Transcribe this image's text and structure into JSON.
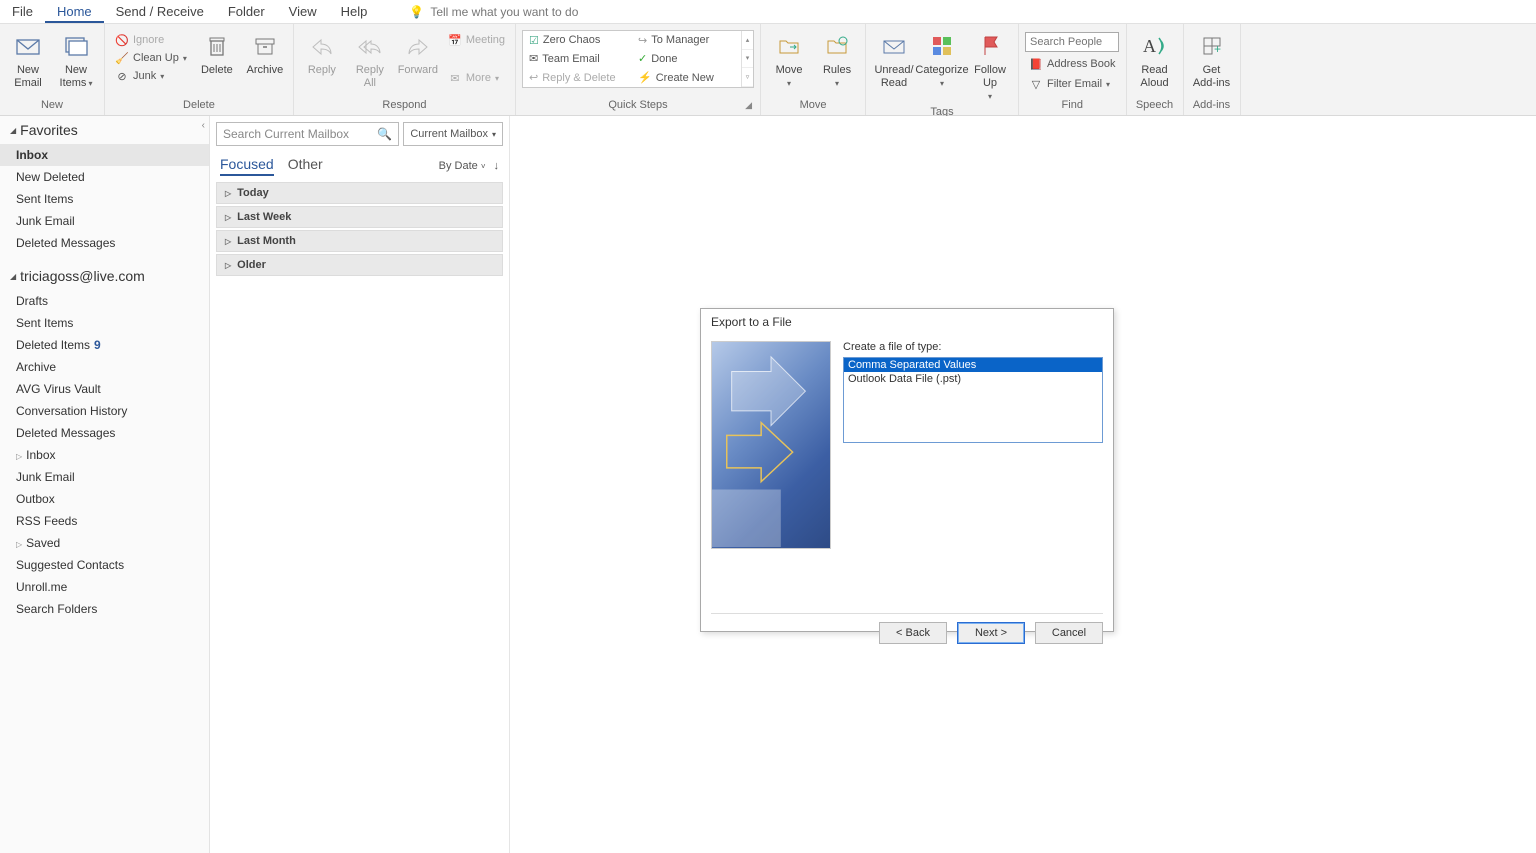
{
  "tabs": {
    "file": "File",
    "home": "Home",
    "send": "Send / Receive",
    "folder": "Folder",
    "view": "View",
    "help": "Help",
    "tellme": "Tell me what you want to do"
  },
  "ribbon": {
    "new": {
      "email": "New Email",
      "items": "New Items",
      "group": "New"
    },
    "delete": {
      "ignore": "Ignore",
      "cleanup": "Clean Up",
      "junk": "Junk",
      "delete": "Delete",
      "archive": "Archive",
      "group": "Delete"
    },
    "respond": {
      "reply": "Reply",
      "replyall": "Reply All",
      "forward": "Forward",
      "meeting": "Meeting",
      "more": "More",
      "group": "Respond"
    },
    "qs": {
      "zero": "Zero Chaos",
      "team": "Team Email",
      "replydel": "Reply & Delete",
      "toman": "To Manager",
      "done": "Done",
      "create": "Create New",
      "group": "Quick Steps"
    },
    "move": {
      "move": "Move",
      "rules": "Rules",
      "group": "Move"
    },
    "tags": {
      "unread": "Unread/ Read",
      "cat": "Categorize",
      "follow": "Follow Up",
      "group": "Tags"
    },
    "find": {
      "searchph": "Search People",
      "ab": "Address Book",
      "filter": "Filter Email",
      "group": "Find"
    },
    "speech": {
      "read": "Read Aloud",
      "group": "Speech"
    },
    "addins": {
      "get": "Get Add-ins",
      "group": "Add-ins"
    }
  },
  "nav": {
    "favorites": "Favorites",
    "fav_items": [
      "Inbox",
      "New Deleted",
      "Sent Items",
      "Junk Email",
      "Deleted Messages"
    ],
    "account": "triciagoss@live.com",
    "acct_items": [
      {
        "t": "Drafts"
      },
      {
        "t": "Sent Items"
      },
      {
        "t": "Deleted Items",
        "c": "9"
      },
      {
        "t": "Archive"
      },
      {
        "t": "AVG Virus Vault"
      },
      {
        "t": "Conversation History"
      },
      {
        "t": "Deleted Messages"
      },
      {
        "t": "Inbox",
        "exp": true
      },
      {
        "t": "Junk Email"
      },
      {
        "t": "Outbox"
      },
      {
        "t": "RSS Feeds"
      },
      {
        "t": "Saved",
        "exp": true
      },
      {
        "t": "Suggested Contacts"
      },
      {
        "t": "Unroll.me"
      },
      {
        "t": "Search Folders"
      }
    ]
  },
  "list": {
    "searchph": "Search Current Mailbox",
    "scope": "Current Mailbox",
    "focused": "Focused",
    "other": "Other",
    "sortby": "By Date",
    "groups": [
      "Today",
      "Last Week",
      "Last Month",
      "Older"
    ]
  },
  "dialog": {
    "title": "Export to a File",
    "label": "Create a file of type:",
    "opts": [
      "Comma Separated Values",
      "Outlook Data File (.pst)"
    ],
    "back": "<  Back",
    "next": "Next  >",
    "cancel": "Cancel"
  }
}
